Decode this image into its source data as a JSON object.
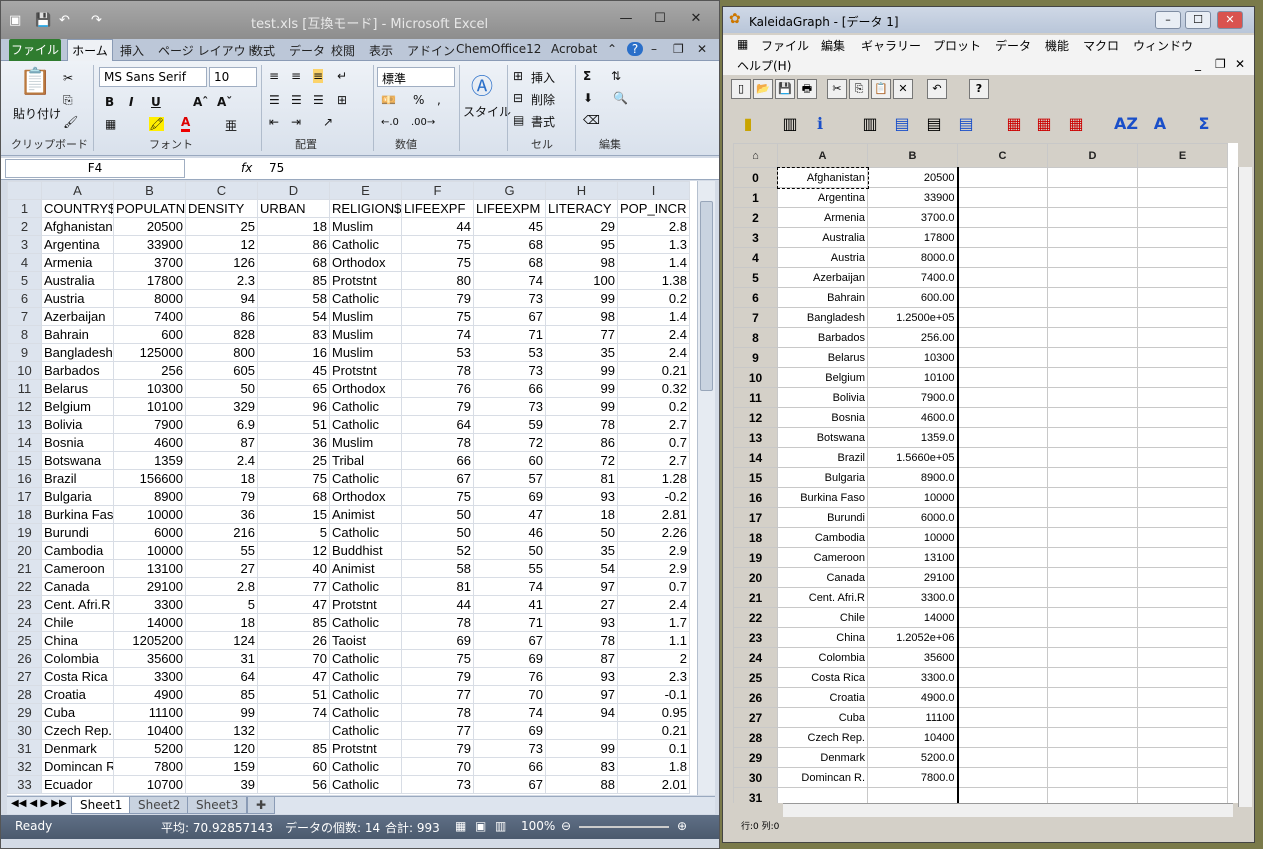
{
  "excel": {
    "title": "test.xls [互換モード] - Microsoft Excel",
    "tabs": [
      "ファイル",
      "ホーム",
      "挿入",
      "ページ レイアウト",
      "数式",
      "データ",
      "校閲",
      "表示",
      "アドイン",
      "ChemOffice12",
      "Acrobat"
    ],
    "font_name": "MS Sans Serif",
    "font_size": "10",
    "number_format": "標準",
    "paste_label": "貼り付け",
    "style_label": "スタイル",
    "insert_label": "挿入",
    "delete_label": "削除",
    "format_label": "書式",
    "groups": [
      "クリップボード",
      "フォント",
      "配置",
      "数値",
      "セル",
      "編集"
    ],
    "name_box": "F4",
    "formula_value": "75",
    "columns": [
      "A",
      "B",
      "C",
      "D",
      "E",
      "F",
      "G",
      "H",
      "I"
    ],
    "rows": [
      [
        "1",
        "COUNTRY$",
        "POPULATN",
        "DENSITY",
        "URBAN",
        "RELIGION$",
        "LIFEEXPF",
        "LIFEEXPM",
        "LITERACY",
        "POP_INCR"
      ],
      [
        "2",
        "Afghanistan",
        "20500",
        "25",
        "18",
        "Muslim",
        "44",
        "45",
        "29",
        "2.8"
      ],
      [
        "3",
        "Argentina",
        "33900",
        "12",
        "86",
        "Catholic",
        "75",
        "68",
        "95",
        "1.3"
      ],
      [
        "4",
        "Armenia",
        "3700",
        "126",
        "68",
        "Orthodox",
        "75",
        "68",
        "98",
        "1.4"
      ],
      [
        "5",
        "Australia",
        "17800",
        "2.3",
        "85",
        "Protstnt",
        "80",
        "74",
        "100",
        "1.38"
      ],
      [
        "6",
        "Austria",
        "8000",
        "94",
        "58",
        "Catholic",
        "79",
        "73",
        "99",
        "0.2"
      ],
      [
        "7",
        "Azerbaijan",
        "7400",
        "86",
        "54",
        "Muslim",
        "75",
        "67",
        "98",
        "1.4"
      ],
      [
        "8",
        "Bahrain",
        "600",
        "828",
        "83",
        "Muslim",
        "74",
        "71",
        "77",
        "2.4"
      ],
      [
        "9",
        "Bangladesh",
        "125000",
        "800",
        "16",
        "Muslim",
        "53",
        "53",
        "35",
        "2.4"
      ],
      [
        "10",
        "Barbados",
        "256",
        "605",
        "45",
        "Protstnt",
        "78",
        "73",
        "99",
        "0.21"
      ],
      [
        "11",
        "Belarus",
        "10300",
        "50",
        "65",
        "Orthodox",
        "76",
        "66",
        "99",
        "0.32"
      ],
      [
        "12",
        "Belgium",
        "10100",
        "329",
        "96",
        "Catholic",
        "79",
        "73",
        "99",
        "0.2"
      ],
      [
        "13",
        "Bolivia",
        "7900",
        "6.9",
        "51",
        "Catholic",
        "64",
        "59",
        "78",
        "2.7"
      ],
      [
        "14",
        "Bosnia",
        "4600",
        "87",
        "36",
        "Muslim",
        "78",
        "72",
        "86",
        "0.7"
      ],
      [
        "15",
        "Botswana",
        "1359",
        "2.4",
        "25",
        "Tribal",
        "66",
        "60",
        "72",
        "2.7"
      ],
      [
        "16",
        "Brazil",
        "156600",
        "18",
        "75",
        "Catholic",
        "67",
        "57",
        "81",
        "1.28"
      ],
      [
        "17",
        "Bulgaria",
        "8900",
        "79",
        "68",
        "Orthodox",
        "75",
        "69",
        "93",
        "-0.2"
      ],
      [
        "18",
        "Burkina Faso",
        "10000",
        "36",
        "15",
        "Animist",
        "50",
        "47",
        "18",
        "2.81"
      ],
      [
        "19",
        "Burundi",
        "6000",
        "216",
        "5",
        "Catholic",
        "50",
        "46",
        "50",
        "2.26"
      ],
      [
        "20",
        "Cambodia",
        "10000",
        "55",
        "12",
        "Buddhist",
        "52",
        "50",
        "35",
        "2.9"
      ],
      [
        "21",
        "Cameroon",
        "13100",
        "27",
        "40",
        "Animist",
        "58",
        "55",
        "54",
        "2.9"
      ],
      [
        "22",
        "Canada",
        "29100",
        "2.8",
        "77",
        "Catholic",
        "81",
        "74",
        "97",
        "0.7"
      ],
      [
        "23",
        "Cent. Afri.R",
        "3300",
        "5",
        "47",
        "Protstnt",
        "44",
        "41",
        "27",
        "2.4"
      ],
      [
        "24",
        "Chile",
        "14000",
        "18",
        "85",
        "Catholic",
        "78",
        "71",
        "93",
        "1.7"
      ],
      [
        "25",
        "China",
        "1205200",
        "124",
        "26",
        "Taoist",
        "69",
        "67",
        "78",
        "1.1"
      ],
      [
        "26",
        "Colombia",
        "35600",
        "31",
        "70",
        "Catholic",
        "75",
        "69",
        "87",
        "2"
      ],
      [
        "27",
        "Costa Rica",
        "3300",
        "64",
        "47",
        "Catholic",
        "79",
        "76",
        "93",
        "2.3"
      ],
      [
        "28",
        "Croatia",
        "4900",
        "85",
        "51",
        "Catholic",
        "77",
        "70",
        "97",
        "-0.1"
      ],
      [
        "29",
        "Cuba",
        "11100",
        "99",
        "74",
        "Catholic",
        "78",
        "74",
        "94",
        "0.95"
      ],
      [
        "30",
        "Czech Rep.",
        "10400",
        "132",
        "",
        "Catholic",
        "77",
        "69",
        "",
        "0.21"
      ],
      [
        "31",
        "Denmark",
        "5200",
        "120",
        "85",
        "Protstnt",
        "79",
        "73",
        "99",
        "0.1"
      ],
      [
        "32",
        "Domincan R",
        "7800",
        "159",
        "60",
        "Catholic",
        "70",
        "66",
        "83",
        "1.8"
      ],
      [
        "33",
        "Ecuador",
        "10700",
        "39",
        "56",
        "Catholic",
        "73",
        "67",
        "88",
        "2.01"
      ]
    ],
    "sheets": [
      "Sheet1",
      "Sheet2",
      "Sheet3"
    ],
    "status": {
      "ready": "Ready",
      "avg": "平均: 70.92857143",
      "count": "データの個数: 14",
      "sum": "合計: 993",
      "zoom": "100%"
    }
  },
  "kaleida": {
    "title": "KaleidaGraph - [データ 1]",
    "menu": [
      "ファイル",
      "編集",
      "ギャラリー",
      "プロット",
      "データ",
      "機能",
      "マクロ",
      "ウィンドウ",
      "ヘルプ(H)"
    ],
    "columns": [
      "A",
      "B",
      "C",
      "D",
      "E"
    ],
    "rows": [
      [
        "0",
        "Afghanistan",
        "20500"
      ],
      [
        "1",
        "Argentina",
        "33900"
      ],
      [
        "2",
        "Armenia",
        "3700.0"
      ],
      [
        "3",
        "Australia",
        "17800"
      ],
      [
        "4",
        "Austria",
        "8000.0"
      ],
      [
        "5",
        "Azerbaijan",
        "7400.0"
      ],
      [
        "6",
        "Bahrain",
        "600.00"
      ],
      [
        "7",
        "Bangladesh",
        "1.2500e+05"
      ],
      [
        "8",
        "Barbados",
        "256.00"
      ],
      [
        "9",
        "Belarus",
        "10300"
      ],
      [
        "10",
        "Belgium",
        "10100"
      ],
      [
        "11",
        "Bolivia",
        "7900.0"
      ],
      [
        "12",
        "Bosnia",
        "4600.0"
      ],
      [
        "13",
        "Botswana",
        "1359.0"
      ],
      [
        "14",
        "Brazil",
        "1.5660e+05"
      ],
      [
        "15",
        "Bulgaria",
        "8900.0"
      ],
      [
        "16",
        "Burkina Faso",
        "10000"
      ],
      [
        "17",
        "Burundi",
        "6000.0"
      ],
      [
        "18",
        "Cambodia",
        "10000"
      ],
      [
        "19",
        "Cameroon",
        "13100"
      ],
      [
        "20",
        "Canada",
        "29100"
      ],
      [
        "21",
        "Cent. Afri.R",
        "3300.0"
      ],
      [
        "22",
        "Chile",
        "14000"
      ],
      [
        "23",
        "China",
        "1.2052e+06"
      ],
      [
        "24",
        "Colombia",
        "35600"
      ],
      [
        "25",
        "Costa Rica",
        "3300.0"
      ],
      [
        "26",
        "Croatia",
        "4900.0"
      ],
      [
        "27",
        "Cuba",
        "11100"
      ],
      [
        "28",
        "Czech Rep.",
        "10400"
      ],
      [
        "29",
        "Denmark",
        "5200.0"
      ],
      [
        "30",
        "Domincan R.",
        "7800.0"
      ],
      [
        "31",
        "",
        ""
      ]
    ],
    "status": "行:0  列:0"
  }
}
